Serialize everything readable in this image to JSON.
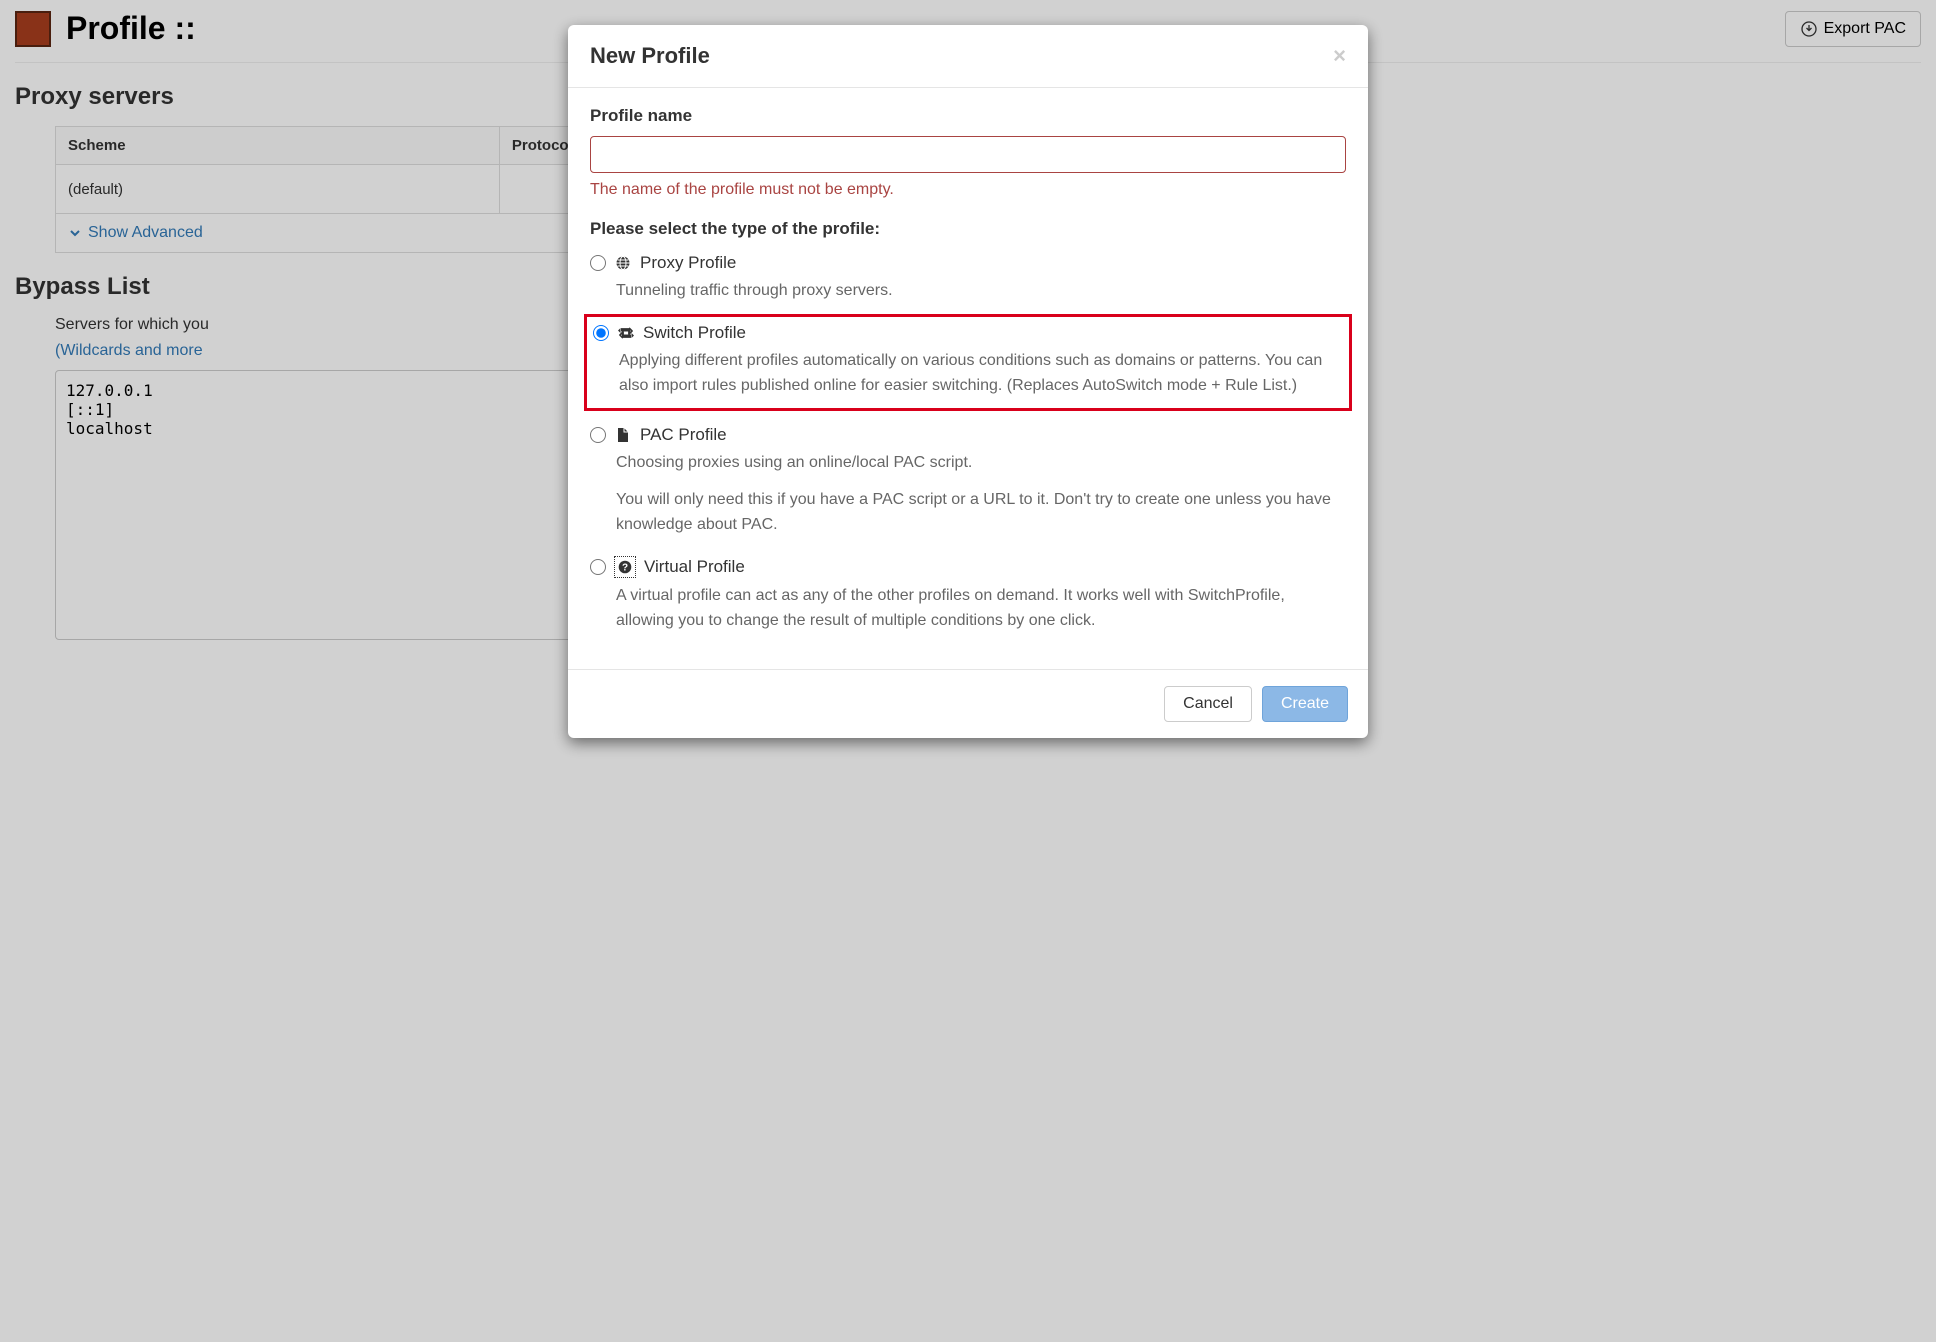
{
  "header": {
    "title_prefix": "Profile :: ",
    "export_label": "Export PAC"
  },
  "proxy": {
    "section_title": "Proxy servers",
    "columns": {
      "scheme": "Scheme",
      "protocol": "Protocol"
    },
    "default_row": {
      "scheme": "(default)"
    },
    "show_advanced": "Show Advanced"
  },
  "bypass": {
    "section_title": "Bypass List",
    "desc": "Servers for which you",
    "link": "(Wildcards and more",
    "value": "127.0.0.1\n[::1]\nlocalhost"
  },
  "modal": {
    "title": "New Profile",
    "name_label": "Profile name",
    "name_error": "The name of the profile must not be empty.",
    "type_label": "Please select the type of the profile:",
    "options": {
      "proxy": {
        "label": "Proxy Profile",
        "desc": "Tunneling traffic through proxy servers."
      },
      "switch": {
        "label": "Switch Profile",
        "desc": "Applying different profiles automatically on various conditions such as domains or patterns. You can also import rules published online for easier switching. (Replaces AutoSwitch mode + Rule List.)"
      },
      "pac": {
        "label": "PAC Profile",
        "desc1": "Choosing proxies using an online/local PAC script.",
        "desc2": "You will only need this if you have a PAC script or a URL to it. Don't try to create one unless you have knowledge about PAC."
      },
      "virtual": {
        "label": "Virtual Profile",
        "desc": "A virtual profile can act as any of the other profiles on demand. It works well with SwitchProfile, allowing you to change the result of multiple conditions by one click."
      }
    },
    "cancel": "Cancel",
    "create": "Create"
  }
}
